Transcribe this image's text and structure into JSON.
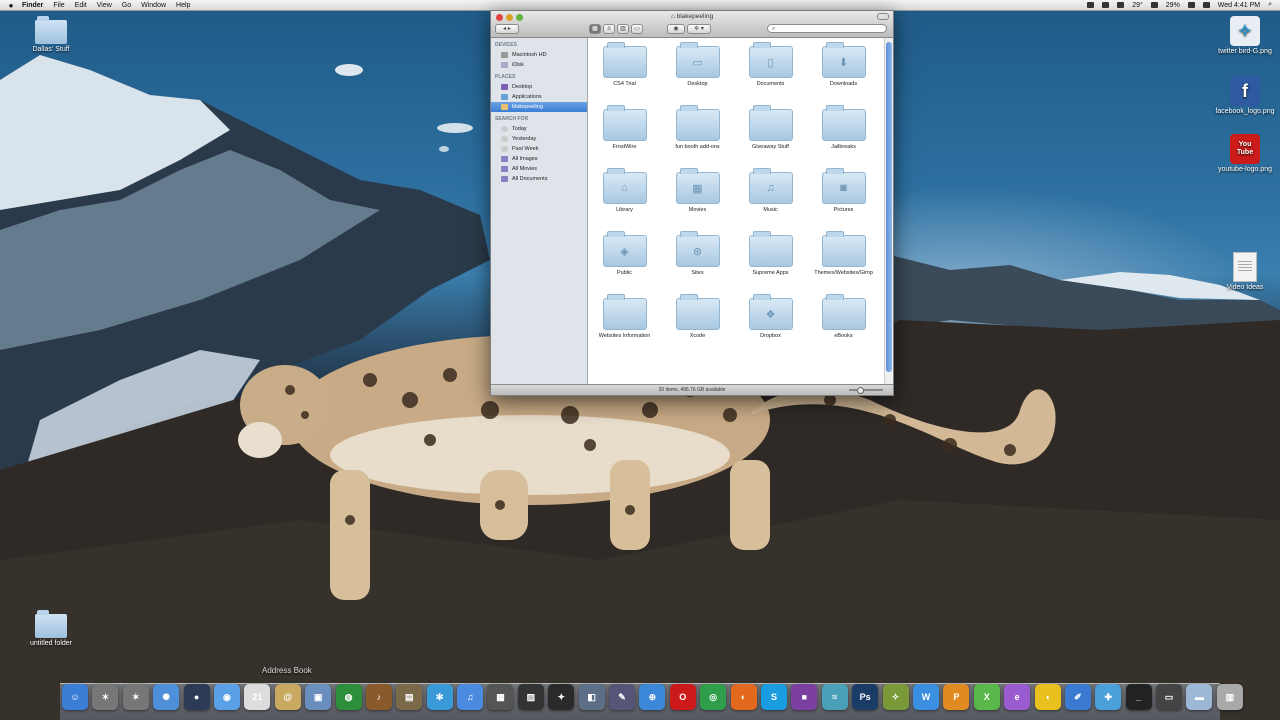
{
  "menubar": {
    "app": "Finder",
    "menus": [
      "File",
      "Edit",
      "View",
      "Go",
      "Window",
      "Help"
    ],
    "temperature": "29°",
    "battery": "29%",
    "clock": "Wed 4:41 PM"
  },
  "desktop": {
    "left_icons": [
      {
        "label": "Dallas' Stuff"
      },
      {
        "label": "untitled folder"
      }
    ],
    "right_icons": [
      {
        "label": "twitter bird-G.png",
        "icon": "twitter-icon",
        "color": "#1f9ad8"
      },
      {
        "label": "facebook_logo.png",
        "icon": "facebook-icon",
        "color": "#2d5aa0"
      },
      {
        "label": "youtube-logo.png",
        "icon": "youtube-icon",
        "color": "#cc1b1b",
        "text": "You Tube"
      },
      {
        "label": "Video Ideas",
        "icon": "document-icon"
      }
    ]
  },
  "finder": {
    "title": "blakepeeling",
    "search_placeholder": "",
    "sidebar": {
      "devices_header": "DEVICES",
      "devices": [
        "Macintosh HD",
        "iDisk"
      ],
      "places_header": "PLACES",
      "places": [
        "Desktop",
        "Applications",
        "blakepeeling"
      ],
      "search_header": "SEARCH FOR",
      "search_for": [
        "Today",
        "Yesterday",
        "Past Week",
        "All Images",
        "All Movies",
        "All Documents"
      ]
    },
    "items": [
      {
        "label": "CS4 Trial",
        "glyph": ""
      },
      {
        "label": "Desktop",
        "glyph": "▭"
      },
      {
        "label": "Documents",
        "glyph": "▯"
      },
      {
        "label": "Downloads",
        "glyph": "⬇"
      },
      {
        "label": "FrostWire",
        "glyph": ""
      },
      {
        "label": "fun booth add-ons",
        "glyph": ""
      },
      {
        "label": "Giveaway Stuff",
        "glyph": ""
      },
      {
        "label": "Jailbreaks",
        "glyph": ""
      },
      {
        "label": "Library",
        "glyph": "⌂"
      },
      {
        "label": "Movies",
        "glyph": "▦"
      },
      {
        "label": "Music",
        "glyph": "♫"
      },
      {
        "label": "Pictures",
        "glyph": "◙"
      },
      {
        "label": "Public",
        "glyph": "◈"
      },
      {
        "label": "Sites",
        "glyph": "⊛"
      },
      {
        "label": "Supreme Apps",
        "glyph": ""
      },
      {
        "label": "Themes/Websites/Gimp",
        "glyph": ""
      },
      {
        "label": "Websites Information",
        "glyph": ""
      },
      {
        "label": "Xcode",
        "glyph": ""
      },
      {
        "label": "Dropbox",
        "glyph": "❖"
      },
      {
        "label": "eBooks",
        "glyph": ""
      }
    ],
    "status": "20 items, 496.76 GB available"
  },
  "dock": {
    "tooltip": "Address Book",
    "items": [
      {
        "name": "finder-icon",
        "color": "#3b7ed6",
        "glyph": "☺"
      },
      {
        "name": "utility-icon",
        "color": "#777777",
        "glyph": "✶"
      },
      {
        "name": "utility2-icon",
        "color": "#777777",
        "glyph": "✶"
      },
      {
        "name": "system-preferences-icon",
        "color": "#4d8fd8",
        "glyph": "✺"
      },
      {
        "name": "drop-icon",
        "color": "#2b3b55",
        "glyph": "●"
      },
      {
        "name": "ichat-icon",
        "color": "#5aa0e6",
        "glyph": "◉"
      },
      {
        "name": "ical-icon",
        "color": "#dddddd",
        "glyph": "21"
      },
      {
        "name": "address-book-icon",
        "color": "#c9a860",
        "glyph": "@"
      },
      {
        "name": "preview-icon",
        "color": "#6a8fbf",
        "glyph": "▣"
      },
      {
        "name": "globe-icon",
        "color": "#2d8f3c",
        "glyph": "◍"
      },
      {
        "name": "guitar-icon",
        "color": "#8a5a2b",
        "glyph": "♪"
      },
      {
        "name": "photo-icon",
        "color": "#7a6a4a",
        "glyph": "▤"
      },
      {
        "name": "snowflake-icon",
        "color": "#3a9ad8",
        "glyph": "✻"
      },
      {
        "name": "itunes-icon",
        "color": "#4a8be0",
        "glyph": "♫"
      },
      {
        "name": "movie-icon",
        "color": "#555555",
        "glyph": "▩"
      },
      {
        "name": "clapper-icon",
        "color": "#333333",
        "glyph": "▨"
      },
      {
        "name": "star-icon",
        "color": "#2a2a2a",
        "glyph": "✦"
      },
      {
        "name": "keynote-icon",
        "color": "#5c6f86",
        "glyph": "◧"
      },
      {
        "name": "pen-icon",
        "color": "#555577",
        "glyph": "✎"
      },
      {
        "name": "safari-icon",
        "color": "#3d87d9",
        "glyph": "⊕"
      },
      {
        "name": "opera-icon",
        "color": "#cc1a1a",
        "glyph": "O"
      },
      {
        "name": "chrome-icon",
        "color": "#2e9e4a",
        "glyph": "◎"
      },
      {
        "name": "firefox-icon",
        "color": "#e2691d",
        "glyph": "◐"
      },
      {
        "name": "skype-icon",
        "color": "#1a9de0",
        "glyph": "S"
      },
      {
        "name": "square-app-icon",
        "color": "#7a3fa0",
        "glyph": "■"
      },
      {
        "name": "fish-icon",
        "color": "#4aa0b8",
        "glyph": "≈"
      },
      {
        "name": "photoshop-icon",
        "color": "#1a3c66",
        "glyph": "Ps"
      },
      {
        "name": "dragon-icon",
        "color": "#7a9a3a",
        "glyph": "✧"
      },
      {
        "name": "w-app-icon",
        "color": "#3b8fe0",
        "glyph": "W"
      },
      {
        "name": "p-app-icon",
        "color": "#e08a22",
        "glyph": "P"
      },
      {
        "name": "x-app-icon",
        "color": "#5ab84a",
        "glyph": "X"
      },
      {
        "name": "e-app-icon",
        "color": "#9a5ad0",
        "glyph": "e"
      },
      {
        "name": "duck-icon",
        "color": "#e8c020",
        "glyph": "◖"
      },
      {
        "name": "write-icon",
        "color": "#3a7ad0",
        "glyph": "✐"
      },
      {
        "name": "puzzle-icon",
        "color": "#4aa0d8",
        "glyph": "✚"
      },
      {
        "name": "terminal-icon",
        "color": "#222222",
        "glyph": "_"
      },
      {
        "name": "display-icon",
        "color": "#444444",
        "glyph": "▭"
      },
      {
        "name": "documents-stack-icon",
        "color": "#9cb8d6",
        "glyph": "▬"
      },
      {
        "name": "trash-icon",
        "color": "#a9a9a9",
        "glyph": "▥"
      }
    ]
  }
}
